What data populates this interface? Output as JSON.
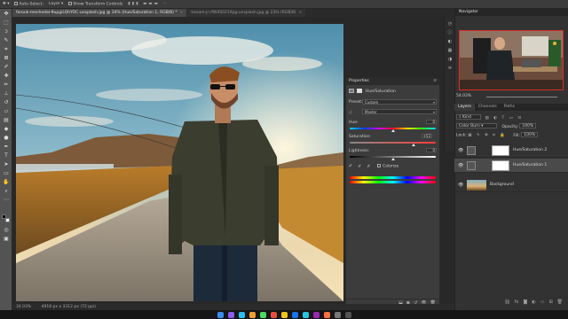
{
  "options_bar": {
    "auto_select": "Auto-Select:",
    "auto_select_value": "Layer",
    "show_transform_controls": "Show Transform Controls"
  },
  "tabs": [
    {
      "label": "farouk-mechedal-9upgiLOhYOC-unsplash.jpg @ 34% (Hue/Saturation 1, RGB/8) *",
      "close": "×"
    },
    {
      "label": "hesam-jr-rfW4S0219yg-unsplash.jpg @ 23% (RGB/8)",
      "close": "×"
    }
  ],
  "status_bar": {
    "zoom": "34.03%",
    "doc_size": "4918 px x 3312 px (72 ppi)"
  },
  "properties": {
    "title": "Properties",
    "panel_name": "Hue/Saturation",
    "preset_label": "Preset:",
    "preset_value": "Custom",
    "channel_value": "Master",
    "hue_label": "Hue:",
    "hue_value": "0",
    "saturation_label": "Saturation:",
    "saturation_value": "+53",
    "lightness_label": "Lightness:",
    "lightness_value": "0",
    "colorize_label": "Colorize"
  },
  "navigator": {
    "title": "Navigator",
    "zoom": "54.03%"
  },
  "layers_panel": {
    "tabs": [
      "Layers",
      "Channels",
      "Paths"
    ],
    "kind_label": "Kind",
    "blend_mode": "Color Burn",
    "opacity_label": "Opacity:",
    "opacity_value": "100%",
    "lock_label": "Lock:",
    "fill_label": "Fill:",
    "fill_value": "100%",
    "layers": [
      {
        "name": "Hue/Saturation 2",
        "selected": false
      },
      {
        "name": "Hue/Saturation 1",
        "selected": true
      },
      {
        "name": "Background",
        "selected": false
      }
    ]
  },
  "colors": {
    "accent": "#2d8ceb",
    "panel": "#3c3c3c",
    "sky_top": "#5f9cb6",
    "sunset": "#f0d8a8"
  },
  "icons": [
    "move-icon",
    "marquee-icon",
    "lasso-icon",
    "crop-icon",
    "eyedropper-icon",
    "brush-icon",
    "eraser-icon",
    "text-icon",
    "hand-icon",
    "zoom-icon",
    "eye-icon",
    "trash-icon"
  ]
}
